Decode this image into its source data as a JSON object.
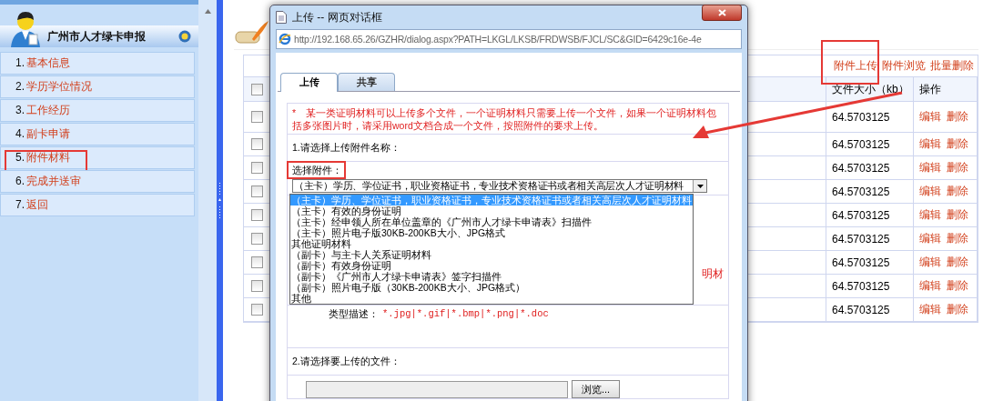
{
  "sidebar": {
    "title": "广州市人才绿卡申报",
    "items": [
      {
        "number": "1.",
        "label": "基本信息",
        "annotated": false
      },
      {
        "number": "2.",
        "label": "学历学位情况",
        "annotated": false
      },
      {
        "number": "3.",
        "label": "工作经历",
        "annotated": false
      },
      {
        "number": "4.",
        "label": "副卡申请",
        "annotated": false
      },
      {
        "number": "5.",
        "label": "附件材料",
        "annotated": true
      },
      {
        "number": "6.",
        "label": "完成并送审",
        "annotated": false
      },
      {
        "number": "7.",
        "label": "返回",
        "annotated": false
      }
    ]
  },
  "table": {
    "toolbar_links": [
      {
        "label": "附件上传",
        "annotated": true
      },
      {
        "label": "附件浏览",
        "annotated": false
      },
      {
        "label": "批量删除",
        "annotated": false
      }
    ],
    "columns": [
      "文件大小（kb）",
      "操作"
    ],
    "header_checked": false,
    "rows": [
      {
        "checked": false,
        "size": "64.5703125",
        "actions": [
          "编辑",
          "删除"
        ]
      },
      {
        "checked": false,
        "size": "64.5703125",
        "actions": [
          "编辑",
          "删除"
        ]
      },
      {
        "checked": false,
        "size": "64.5703125",
        "actions": [
          "编辑",
          "删除"
        ]
      },
      {
        "checked": false,
        "size": "64.5703125",
        "actions": [
          "编辑",
          "删除"
        ]
      },
      {
        "checked": false,
        "size": "64.5703125",
        "actions": [
          "编辑",
          "删除"
        ]
      },
      {
        "checked": false,
        "size": "64.5703125",
        "actions": [
          "编辑",
          "删除"
        ]
      },
      {
        "checked": false,
        "size": "64.5703125",
        "actions": [
          "编辑",
          "删除"
        ]
      },
      {
        "checked": false,
        "size": "64.5703125",
        "actions": [
          "编辑",
          "删除"
        ]
      },
      {
        "checked": false,
        "size": "64.5703125",
        "actions": [
          "编辑",
          "删除"
        ]
      }
    ]
  },
  "dialog": {
    "title": "上传 -- 网页对话框",
    "url": "http://192.168.65.26/GZHR/dialog.aspx?PATH=LKGL/LKSB/FRDWSB/FJCL/SC&GID=6429c16e-4e",
    "tabs": [
      {
        "label": "上传",
        "selected": true
      },
      {
        "label": "共享",
        "selected": false
      }
    ],
    "notice": "*　某一类证明材料可以上传多个文件，一个证明材料只需要上传一个文件，如果一个证明材料包括多张图片时，请采用word文档合成一个文件，按照附件的要求上传。",
    "step1": "1.请选择上传附件名称：",
    "select_label": "选择附件：",
    "select_label_annotated": true,
    "select_value": "（主卡）学历、学位证书，职业资格证书，专业技术资格证书或者相关高层次人才证明材料",
    "options": [
      {
        "label": "（主卡）学历、学位证书，职业资格证书，专业技术资格证书或者相关高层次人才证明材料",
        "selected": true
      },
      {
        "label": "（主卡）有效的身份证明",
        "selected": false
      },
      {
        "label": "（主卡）经申领人所在单位盖章的《广州市人才绿卡申请表》扫描件",
        "selected": false
      },
      {
        "label": "（主卡）照片电子版30KB-200KB大小、JPG格式",
        "selected": false
      },
      {
        "label": "其他证明材料",
        "selected": false
      },
      {
        "label": "（副卡）与主卡人关系证明材料",
        "selected": false
      },
      {
        "label": "（副卡）有效身份证明",
        "selected": false
      },
      {
        "label": "（副卡）《广州市人才绿卡申请表》签字扫描件",
        "selected": false
      },
      {
        "label": "（副卡）照片电子版（30KB-200KB大小、JPG格式）",
        "selected": false
      },
      {
        "label": "其他",
        "selected": false
      }
    ],
    "hidden_note_tail": "明材",
    "type_label": "类型描述：",
    "type_value": "*.jpg|*.gif|*.bmp|*.png|*.doc",
    "step2": "2.请选择要上传的文件：",
    "browse_button": "浏览..."
  }
}
